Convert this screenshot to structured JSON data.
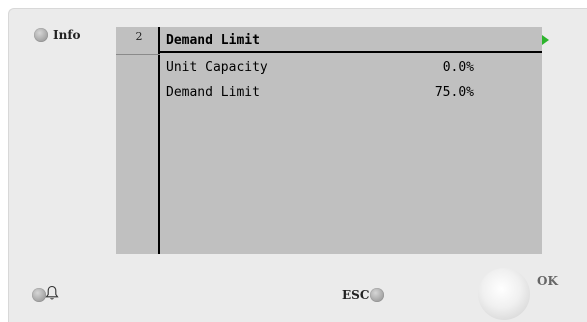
{
  "header": {
    "info_label": "Info"
  },
  "screen": {
    "page_number": "2",
    "title": "Demand Limit",
    "rows": [
      {
        "label": "Unit Capacity",
        "value": "0.0%"
      },
      {
        "label": "Demand Limit",
        "value": "75.0%"
      }
    ]
  },
  "footer": {
    "esc_label": "ESC",
    "ok_label": "OK"
  },
  "icons": {
    "bell": "bell-icon",
    "next": "play-arrow-icon"
  },
  "colors": {
    "screen_bg": "#c0c0c0",
    "panel_bg": "#ebebeb",
    "arrow": "#2db52d"
  }
}
